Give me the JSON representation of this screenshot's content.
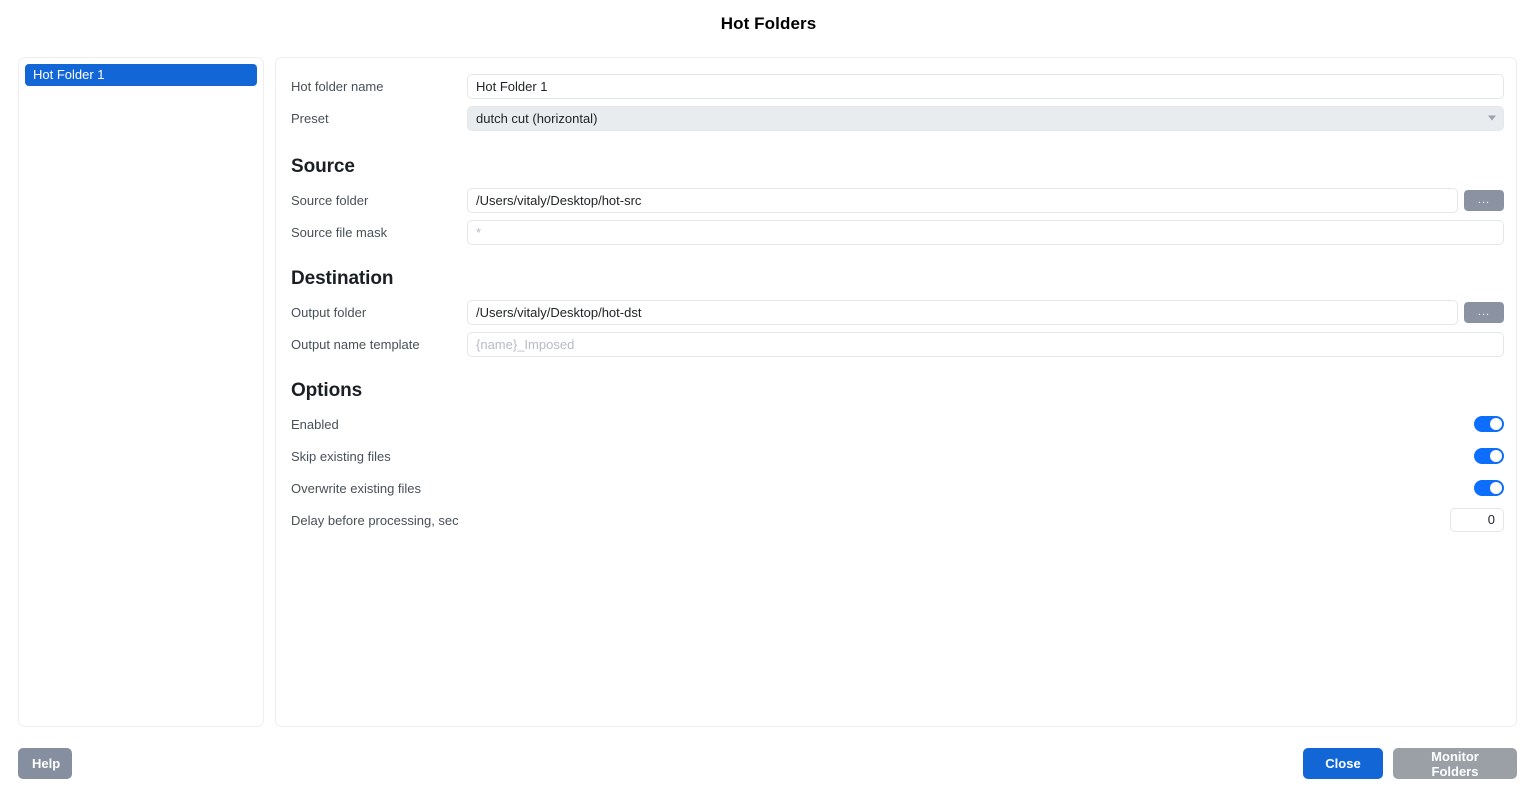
{
  "window": {
    "title": "Hot Folders"
  },
  "colors": {
    "accent": "#1266d6",
    "toggle_on": "#0d6efd",
    "muted_button": "#868fa0",
    "disabled_button": "#9aa0a6",
    "browse_button": "#8b93a3",
    "select_bg": "#e9ecef"
  },
  "sidebar": {
    "items": [
      {
        "label": "Hot Folder 1",
        "selected": true
      }
    ]
  },
  "form": {
    "name_row": {
      "label": "Hot folder name",
      "value": "Hot Folder 1"
    },
    "preset_row": {
      "label": "Preset",
      "value": "dutch cut (horizontal)",
      "chevron": "chevron-down-icon"
    },
    "source": {
      "heading": "Source",
      "folder": {
        "label": "Source folder",
        "value": "/Users/vitaly/Desktop/hot-src",
        "browse_label": "..."
      },
      "mask": {
        "label": "Source file mask",
        "value": "",
        "placeholder": "*"
      }
    },
    "destination": {
      "heading": "Destination",
      "folder": {
        "label": "Output folder",
        "value": "/Users/vitaly/Desktop/hot-dst",
        "browse_label": "..."
      },
      "template": {
        "label": "Output name template",
        "value": "",
        "placeholder": "{name}_Imposed"
      }
    },
    "options": {
      "heading": "Options",
      "enabled": {
        "label": "Enabled",
        "on": true
      },
      "skip_existing": {
        "label": "Skip existing files",
        "on": true
      },
      "overwrite_existing": {
        "label": "Overwrite existing files",
        "on": true
      },
      "delay": {
        "label": "Delay before processing, sec",
        "value": "0"
      }
    }
  },
  "footer": {
    "help_label": "Help",
    "close_label": "Close",
    "monitor_label": "Monitor Folders"
  }
}
